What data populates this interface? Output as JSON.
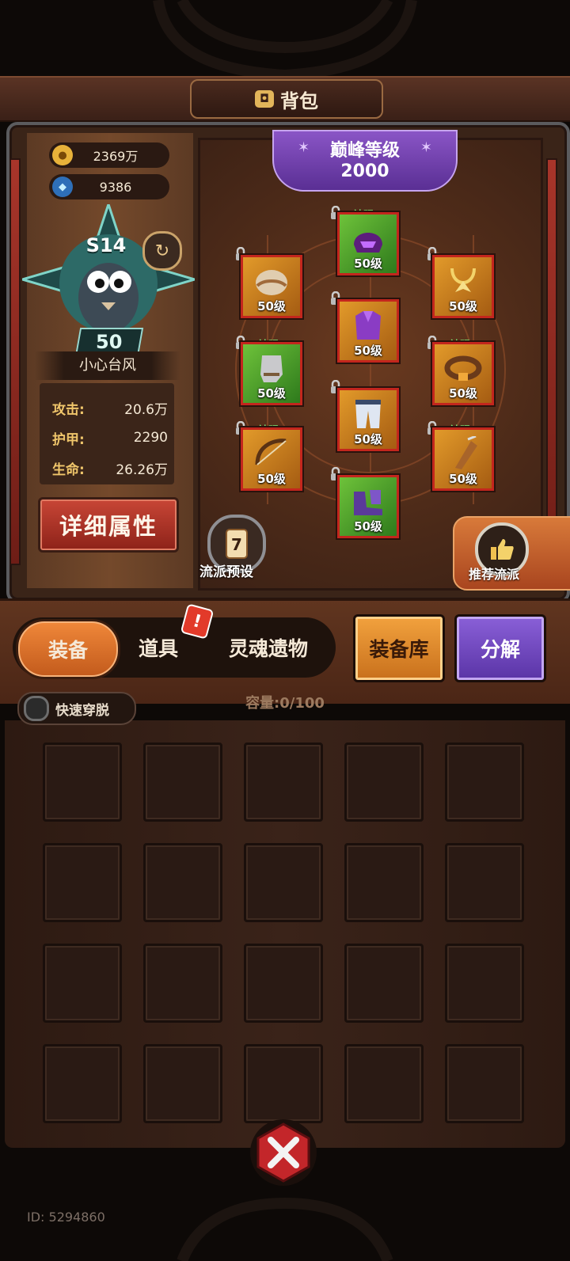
{
  "header": {
    "title": "背包"
  },
  "currency": {
    "gold": "2369万",
    "gems": "9386"
  },
  "hero": {
    "season": "S14",
    "level": "50",
    "name": "小心台风",
    "stats": [
      {
        "label": "攻击:",
        "value": "20.6万"
      },
      {
        "label": "护甲:",
        "value": "2290"
      },
      {
        "label": "生命:",
        "value": "26.26万"
      }
    ],
    "detail_button": "详细属性"
  },
  "peak": {
    "label": "巅峰等级",
    "value": "2000"
  },
  "equipment": [
    {
      "slot": "helmet",
      "tag": "神赐",
      "level": "50级",
      "rarity": "god",
      "locked": true
    },
    {
      "slot": "pauldron",
      "tag": "",
      "level": "50级",
      "rarity": "gold",
      "locked": true
    },
    {
      "slot": "necklace",
      "tag": "",
      "level": "50级",
      "rarity": "gold",
      "locked": true
    },
    {
      "slot": "armor",
      "tag": "",
      "level": "50级",
      "rarity": "gold",
      "locked": true
    },
    {
      "slot": "gloves",
      "tag": "神赐",
      "level": "50级",
      "rarity": "god",
      "locked": true
    },
    {
      "slot": "belt",
      "tag": "神赐",
      "level": "50级",
      "rarity": "gold",
      "locked": true
    },
    {
      "slot": "pants",
      "tag": "",
      "level": "50级",
      "rarity": "gold",
      "locked": true
    },
    {
      "slot": "bow",
      "tag": "神赐",
      "level": "50级",
      "rarity": "gold",
      "locked": true
    },
    {
      "slot": "quiver",
      "tag": "神赐",
      "level": "50级",
      "rarity": "gold",
      "locked": true
    },
    {
      "slot": "boots",
      "tag": "",
      "level": "50级",
      "rarity": "god",
      "locked": true
    }
  ],
  "buttons": {
    "preset": "流派预设",
    "recommend": "推荐流派",
    "store": "装备库",
    "decompose": "分解",
    "quick_swap": "快速穿脱"
  },
  "tabs": [
    {
      "label": "装备",
      "active": true
    },
    {
      "label": "道具",
      "active": false,
      "alert": "!"
    },
    {
      "label": "灵魂遗物",
      "active": false
    }
  ],
  "inventory": {
    "capacity": "容量:0/100",
    "visible_slots": 20
  },
  "footer": {
    "id": "ID: 5294860"
  },
  "colors": {
    "accent_orange": "#e27a30",
    "accent_purple": "#6e44b8",
    "slot_border": "#c3261d",
    "god_green": "#4aa52a"
  }
}
